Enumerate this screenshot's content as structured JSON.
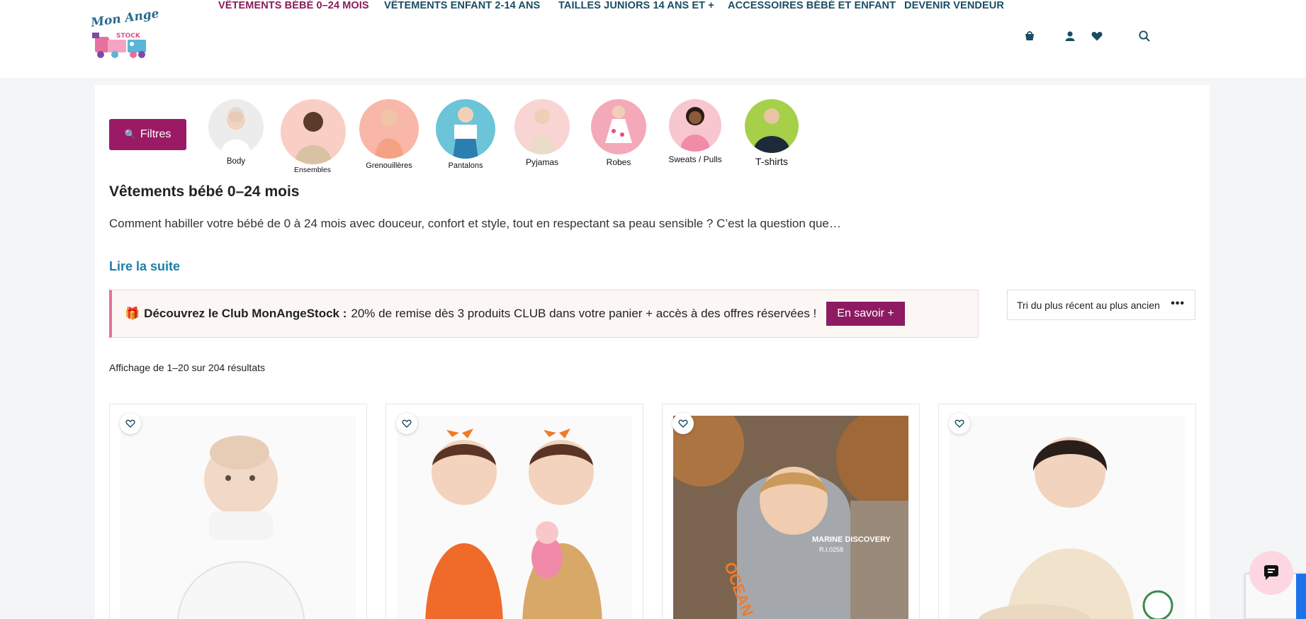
{
  "brand": {
    "logo_script": "Mon Ange",
    "logo_stock": "STOCK"
  },
  "nav": {
    "items": [
      {
        "label": "VÊTEMENTS BÉBÉ 0–24 MOIS"
      },
      {
        "label": "VÊTEMENTS ENFANT 2-14 ANS"
      },
      {
        "label": "TAILLES JUNIORS 14 ANS ET +"
      },
      {
        "label": "ACCESSOIRES BÉBÉ ET ENFANT"
      },
      {
        "label": "DEVENIR VENDEUR"
      }
    ],
    "icons": [
      "cart-icon",
      "account-icon",
      "wishlist-icon",
      "search-icon"
    ]
  },
  "filters": {
    "label": "Filtres",
    "icon": "search-icon"
  },
  "categories": [
    {
      "label": "Body"
    },
    {
      "label": "Ensembles"
    },
    {
      "label": "Grenouillères"
    },
    {
      "label": "Pantalons"
    },
    {
      "label": "Pyjamas"
    },
    {
      "label": "Robes"
    },
    {
      "label": "Sweats / Pulls"
    },
    {
      "label": "T-shirts"
    }
  ],
  "page": {
    "title": "Vêtements bébé 0–24 mois",
    "intro": "Comment habiller votre bébé de 0 à 24 mois avec douceur, confort et style, tout en respectant sa peau sensible ? C’est la question que…",
    "read_more": "Lire la suite"
  },
  "club": {
    "icon": "gift-icon",
    "title": "Découvrez le Club MonAngeStock :",
    "text": "20% de remise dès 3 produits CLUB dans votre panier + accès à des offres réservées !",
    "cta": "En savoir +"
  },
  "sort": {
    "label": "Tri du plus récent au plus ancien"
  },
  "results": {
    "text": "Affichage de 1–20 sur 204 résultats"
  },
  "products": [
    {
      "alt": "Body col roulé blanc bébé"
    },
    {
      "alt": "Bodies bébé orange et moutarde"
    },
    {
      "alt": "Sweat à capuche gris OCEAN"
    },
    {
      "alt": "Ensemble bébé matelassé beige"
    }
  ],
  "product_print": {
    "sweat_back": "MARINE DISCOVERY",
    "sweat_code": "R.I.0258",
    "sweat_sleeve": "OCEAN"
  },
  "colors": {
    "accent": "#9a1a66",
    "nav": "#1a4d63",
    "link": "#1e7ea8",
    "club_border": "#e8709e"
  }
}
